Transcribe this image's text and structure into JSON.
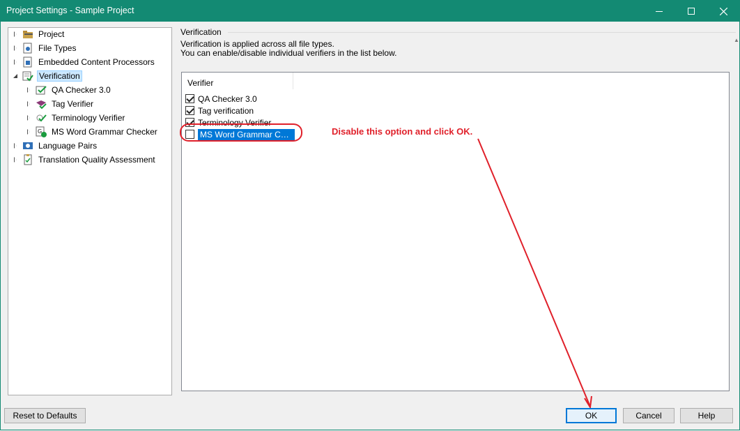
{
  "window": {
    "title": "Project Settings - Sample Project",
    "controls": {
      "minimize": "minimize-icon",
      "maximize": "maximize-icon",
      "close": "close-icon"
    },
    "accent_color": "#138a73"
  },
  "tree": {
    "items": [
      {
        "label": "Project",
        "icon": "folder-icon",
        "state": "collapsed",
        "level": 0
      },
      {
        "label": "File Types",
        "icon": "file-types-icon",
        "state": "collapsed",
        "level": 0
      },
      {
        "label": "Embedded Content Processors",
        "icon": "processor-icon",
        "state": "collapsed",
        "level": 0
      },
      {
        "label": "Verification",
        "icon": "verification-icon",
        "state": "expanded",
        "level": 0,
        "selected": true
      },
      {
        "label": "QA Checker 3.0",
        "icon": "qa-checker-icon",
        "state": "collapsed",
        "level": 1
      },
      {
        "label": "Tag Verifier",
        "icon": "tag-verifier-icon",
        "state": "collapsed",
        "level": 1
      },
      {
        "label": "Terminology Verifier",
        "icon": "terminology-verifier-icon",
        "state": "collapsed",
        "level": 1
      },
      {
        "label": "MS Word Grammar Checker",
        "icon": "grammar-checker-icon",
        "state": "collapsed",
        "level": 1
      },
      {
        "label": "Language Pairs",
        "icon": "language-pairs-icon",
        "state": "collapsed",
        "level": 0
      },
      {
        "label": "Translation Quality Assessment",
        "icon": "tqa-icon",
        "state": "collapsed",
        "level": 0
      }
    ]
  },
  "verification": {
    "group_title": "Verification",
    "description_line1": "Verification is applied across all file types.",
    "description_line2": "You can enable/disable individual verifiers in the list below.",
    "column_header": "Verifier",
    "verifiers": [
      {
        "label": "QA Checker 3.0",
        "checked": true
      },
      {
        "label": "Tag verification",
        "checked": true
      },
      {
        "label": "Terminology Verifier",
        "checked": true
      },
      {
        "label": "MS Word Grammar Chec...",
        "checked": false,
        "selected": true
      }
    ]
  },
  "annotation": {
    "text": "Disable this option and click OK.",
    "color": "#e0202a"
  },
  "buttons": {
    "reset": "Reset to Defaults",
    "ok": "OK",
    "cancel": "Cancel",
    "help": "Help"
  }
}
